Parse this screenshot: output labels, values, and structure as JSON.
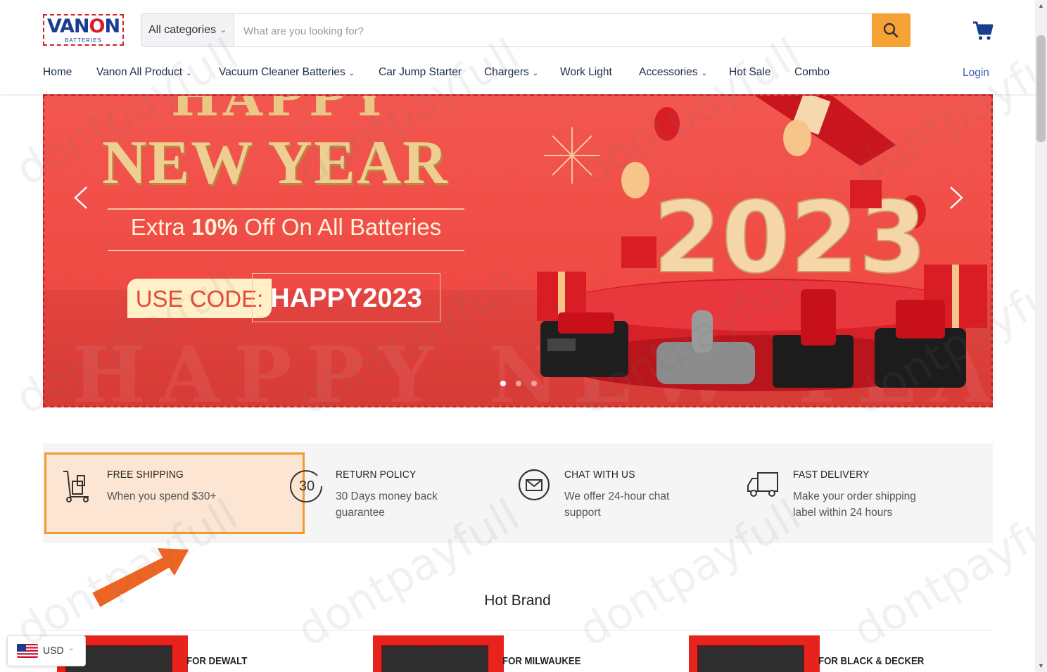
{
  "header": {
    "logo_text": "VANON",
    "logo_sub": "BATTERIES",
    "category_label": "All categories",
    "search_placeholder": "What are you looking for?",
    "login_label": "Login"
  },
  "nav": {
    "items": [
      {
        "label": "Home",
        "dropdown": false
      },
      {
        "label": "Vanon All Product",
        "dropdown": true
      },
      {
        "label": "Vacuum Cleaner Batteries",
        "dropdown": true
      },
      {
        "label": "Car Jump Starter",
        "dropdown": false
      },
      {
        "label": "Chargers",
        "dropdown": true
      },
      {
        "label": "Work Light",
        "dropdown": false
      },
      {
        "label": "Accessories",
        "dropdown": true
      },
      {
        "label": "Hot Sale",
        "dropdown": false
      },
      {
        "label": "Combo",
        "dropdown": false
      }
    ]
  },
  "banner": {
    "title_top": "HAPPY",
    "title_main": "NEW YEAR",
    "offer_pre": "Extra ",
    "offer_bold": "10%",
    "offer_post": " Off On All Batteries",
    "code_label": "USE CODE:",
    "code_value": "HAPPY2023",
    "year": "2023",
    "ghost_text": "HAPPY NEW YEAR",
    "slide_count": 3,
    "active_slide": 1
  },
  "features": [
    {
      "title": "Free Shipping",
      "desc": "When you spend $30+",
      "icon": "delivery-cart-icon"
    },
    {
      "title": "Return Policy",
      "desc": "30 Days money back guarantee",
      "icon": "thirty-days-icon",
      "icon_text": "30"
    },
    {
      "title": "Chat With Us",
      "desc": "We offer 24-hour chat support",
      "icon": "chat-mail-icon"
    },
    {
      "title": "Fast Delivery",
      "desc": "Make your order shipping label within 24 hours",
      "icon": "truck-icon"
    }
  ],
  "promo_badge": "dontpayfull",
  "hot_brand": {
    "title": "Hot Brand",
    "brands": [
      {
        "name": "For Dewalt"
      },
      {
        "name": "For Milwaukee"
      },
      {
        "name": "For Black & Decker"
      }
    ]
  },
  "currency": {
    "code": "USD"
  },
  "watermark": "dontpayfull",
  "colors": {
    "accent": "#f7a234",
    "brand_red": "#d41e2a",
    "navy": "#1c2b4a",
    "link": "#3a5ea8"
  }
}
